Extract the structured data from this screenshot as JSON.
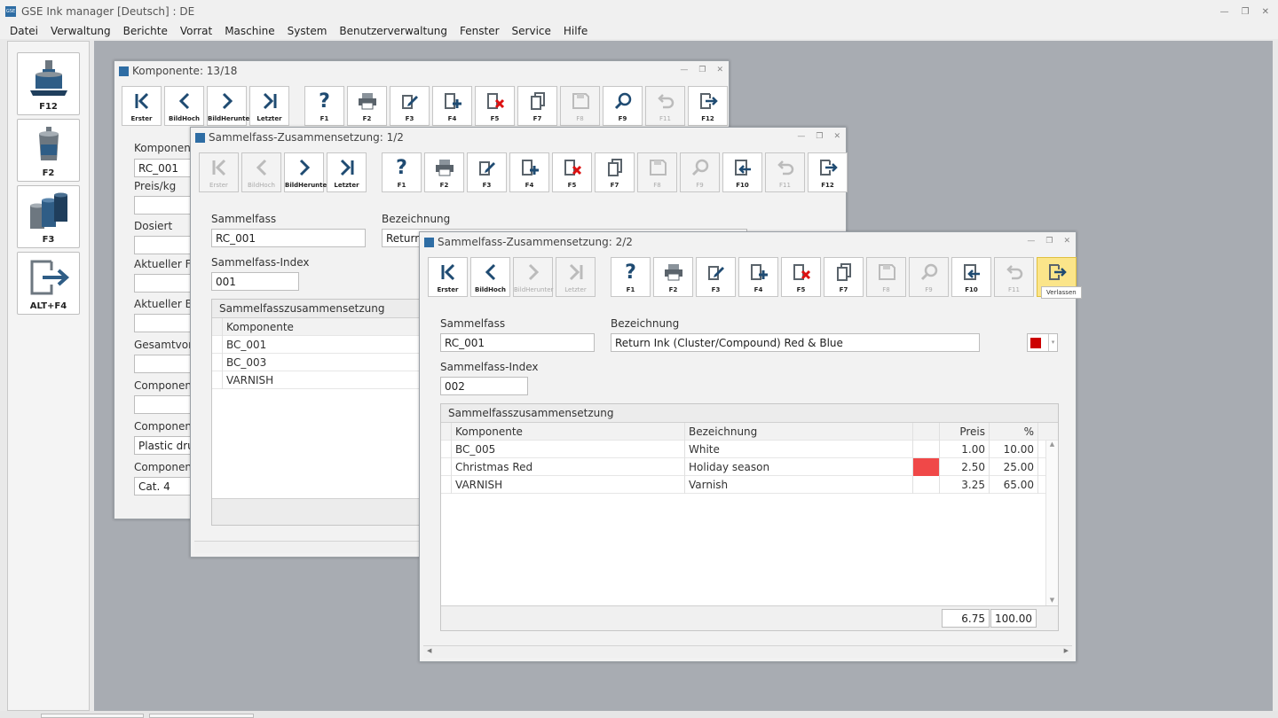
{
  "app": {
    "title": "GSE Ink manager [Deutsch] : DE",
    "logo": "GSE"
  },
  "menu": [
    "Datei",
    "Verwaltung",
    "Berichte",
    "Vorrat",
    "Maschine",
    "System",
    "Benutzerverwaltung",
    "Fenster",
    "Service",
    "Hilfe"
  ],
  "sidebar": [
    {
      "label": "F12",
      "icon": "ink-dispenser-icon"
    },
    {
      "label": "F2",
      "icon": "ink-bucket-icon"
    },
    {
      "label": "F3",
      "icon": "drums-icon"
    },
    {
      "label": "ALT+F4",
      "icon": "exit-icon"
    }
  ],
  "toolbar_labels": {
    "erster": "Erster",
    "bildhoch": "BildHoch",
    "bildrunter": "BildHerunter",
    "letzter": "Letzter",
    "f1": "F1",
    "f2": "F2",
    "f3": "F3",
    "f4": "F4",
    "f5": "F5",
    "f7": "F7",
    "f8": "F8",
    "f9": "F9",
    "f10": "F10",
    "f11": "F11",
    "f12": "F12"
  },
  "win1": {
    "title": "Komponente: 13/18",
    "labels": [
      "Komponent",
      "Preis/kg",
      "Dosiert",
      "Aktueller Fa",
      "Aktueller Be",
      "Gesamtvorr",
      "Component",
      "Component",
      "Component"
    ],
    "values": {
      "komponente": "RC_001",
      "component_b": "Plastic drur",
      "component_c": "Cat. 4"
    }
  },
  "win2": {
    "title": "Sammelfass-Zusammensetzung: 1/2",
    "sammelfass_label": "Sammelfass",
    "sammelfass_value": "RC_001",
    "bezeichnung_label": "Bezeichnung",
    "bezeichnung_value": "Return",
    "index_label": "Sammelfass-Index",
    "index_value": "001",
    "grid_title": "Sammelfasszusammensetzung",
    "col_komponente": "Komponente",
    "rows": [
      "BC_001",
      "BC_003",
      "VARNISH"
    ]
  },
  "win3": {
    "title": "Sammelfass-Zusammensetzung: 2/2",
    "sammelfass_label": "Sammelfass",
    "sammelfass_value": "RC_001",
    "bezeichnung_label": "Bezeichnung",
    "bezeichnung_value": "Return Ink (Cluster/Compound) Red & Blue",
    "index_label": "Sammelfass-Index",
    "index_value": "002",
    "grid_title": "Sammelfasszusammensetzung",
    "columns": {
      "komponente": "Komponente",
      "bezeichnung": "Bezeichnung",
      "preis": "Preis",
      "pct": "%"
    },
    "rows": [
      {
        "komponente": "BC_005",
        "bezeichnung": "White",
        "color": "",
        "preis": "1.00",
        "pct": "10.00"
      },
      {
        "komponente": "Christmas Red",
        "bezeichnung": "Holiday season",
        "color": "#f04848",
        "preis": "2.50",
        "pct": "25.00"
      },
      {
        "komponente": "VARNISH",
        "bezeichnung": "Varnish",
        "color": "",
        "preis": "3.25",
        "pct": "65.00"
      }
    ],
    "total_preis": "6.75",
    "total_pct": "100.00",
    "color_swatch": "#cc0000",
    "tooltip": "Verlassen"
  }
}
